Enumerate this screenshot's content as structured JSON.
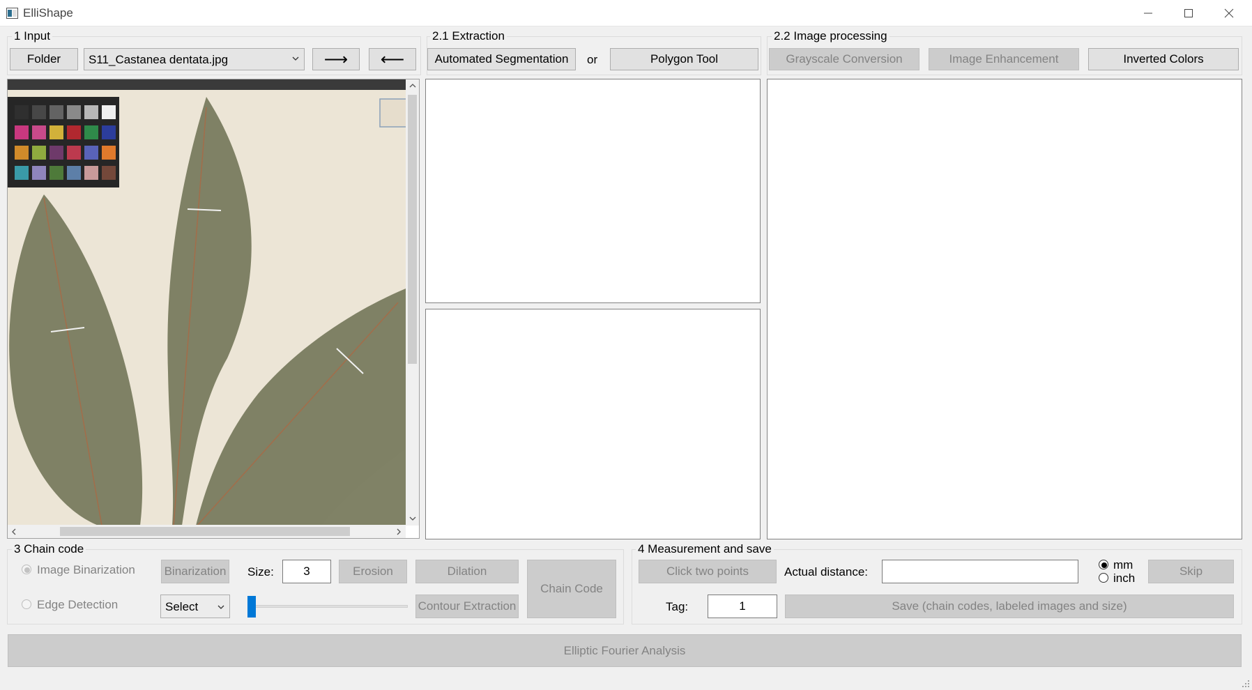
{
  "window": {
    "title": "ElliShape",
    "minimize_glyph": "—",
    "maximize_glyph": "☐",
    "close_glyph": "✕"
  },
  "input": {
    "group_title": "1 Input",
    "folder_label": "Folder",
    "file_selected": "S11_Castanea dentata.jpg",
    "next_label": "⟶",
    "prev_label": "⟵",
    "image_caption": "Herbarium leaf specimen with color calibration card"
  },
  "extraction": {
    "group_title": "2.1 Extraction",
    "auto_seg_label": "Automated Segmentation",
    "or_label": "or",
    "polygon_label": "Polygon Tool"
  },
  "processing": {
    "group_title": "2.2 Image processing",
    "grayscale_label": "Grayscale Conversion",
    "enhance_label": "Image Enhancement",
    "invert_label": "Inverted Colors"
  },
  "chaincode": {
    "group_title": "3 Chain code",
    "binarization_radio": "Image Binarization",
    "edge_radio": "Edge Detection",
    "binarization_btn": "Binarization",
    "size_label": "Size:",
    "size_value": "3",
    "erosion_label": "Erosion",
    "dilation_label": "Dilation",
    "select_value": "Select",
    "contour_label": "Contour Extraction",
    "chaincode_label": "Chain Code",
    "slider_value": 0
  },
  "measurement": {
    "group_title": "4 Measurement and save",
    "click_points_label": "Click two points",
    "actual_distance_label": "Actual distance:",
    "actual_distance_value": "",
    "unit_mm": "mm",
    "unit_inch": "inch",
    "skip_label": "Skip",
    "tag_label": "Tag:",
    "tag_value": "1",
    "save_label": "Save (chain codes, labeled images and size)"
  },
  "efa": {
    "label": "Elliptic Fourier Analysis"
  },
  "colors": {
    "window_bg": "#f0f0f0",
    "button_bg": "#e1e1e1",
    "disabled_bg": "#cccccc",
    "accent": "#0078d7",
    "leaf": "#7f8165",
    "paper": "#ece5d6"
  },
  "icons": {
    "app": "app-window-icon",
    "dropdown": "chevron-down-icon",
    "scroll_up": "chevron-up-icon",
    "scroll_down": "chevron-down-icon",
    "scroll_left": "chevron-left-icon",
    "scroll_right": "chevron-right-icon"
  },
  "swatches": {
    "row1": [
      "#2f2f2f",
      "#474747",
      "#636363",
      "#8a8a8a",
      "#b8b8b8",
      "#efefef"
    ],
    "row2": [
      "#c8387f",
      "#c84a8a",
      "#d2b13a",
      "#b1282f",
      "#2f8a4a",
      "#2c3d9c"
    ],
    "row3": [
      "#d08a2a",
      "#8faa3f",
      "#6e3a6a",
      "#bc3a4e",
      "#5963b8",
      "#e07a2c"
    ],
    "row4": [
      "#3a9aa8",
      "#8f85bc",
      "#4e7a3a",
      "#5d7fa8",
      "#c89a9a",
      "#74483a"
    ]
  }
}
